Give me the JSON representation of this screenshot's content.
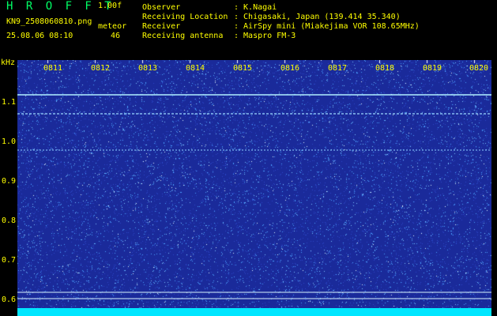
{
  "header": {
    "app_title": "H R O F F T",
    "version": "1.00f",
    "file_name": "KN9_2508060810.png",
    "meteor_label": "meteor",
    "meteor_count": "46",
    "date_time": "25.08.06 08:10"
  },
  "metadata": [
    {
      "key": "Observer",
      "value": ": K.Nagai"
    },
    {
      "key": "Receiving Location",
      "value": ": Chigasaki, Japan (139.414 35.340)"
    },
    {
      "key": "Receiver",
      "value": ": AirSpy mini (Miakejima VOR 108.65MHz)"
    },
    {
      "key": "Receiving antenna",
      "value": ": Maspro FM-3"
    }
  ],
  "spectrogram": {
    "unit_label": "kHz",
    "y_ticks": [
      "1.1",
      "1.0",
      "0.9",
      "0.8",
      "0.7",
      "0.6"
    ],
    "x_ticks": [
      "0811",
      "0812",
      "0813",
      "0814",
      "0815",
      "0816",
      "0817",
      "0818",
      "0819",
      "0820"
    ],
    "colors": {
      "background": "#1a2a9a",
      "noise": "#4aa0ff",
      "trace": "#a8e8ff",
      "floor": "#00e6ff",
      "axis_text": "#ffff00"
    }
  }
}
